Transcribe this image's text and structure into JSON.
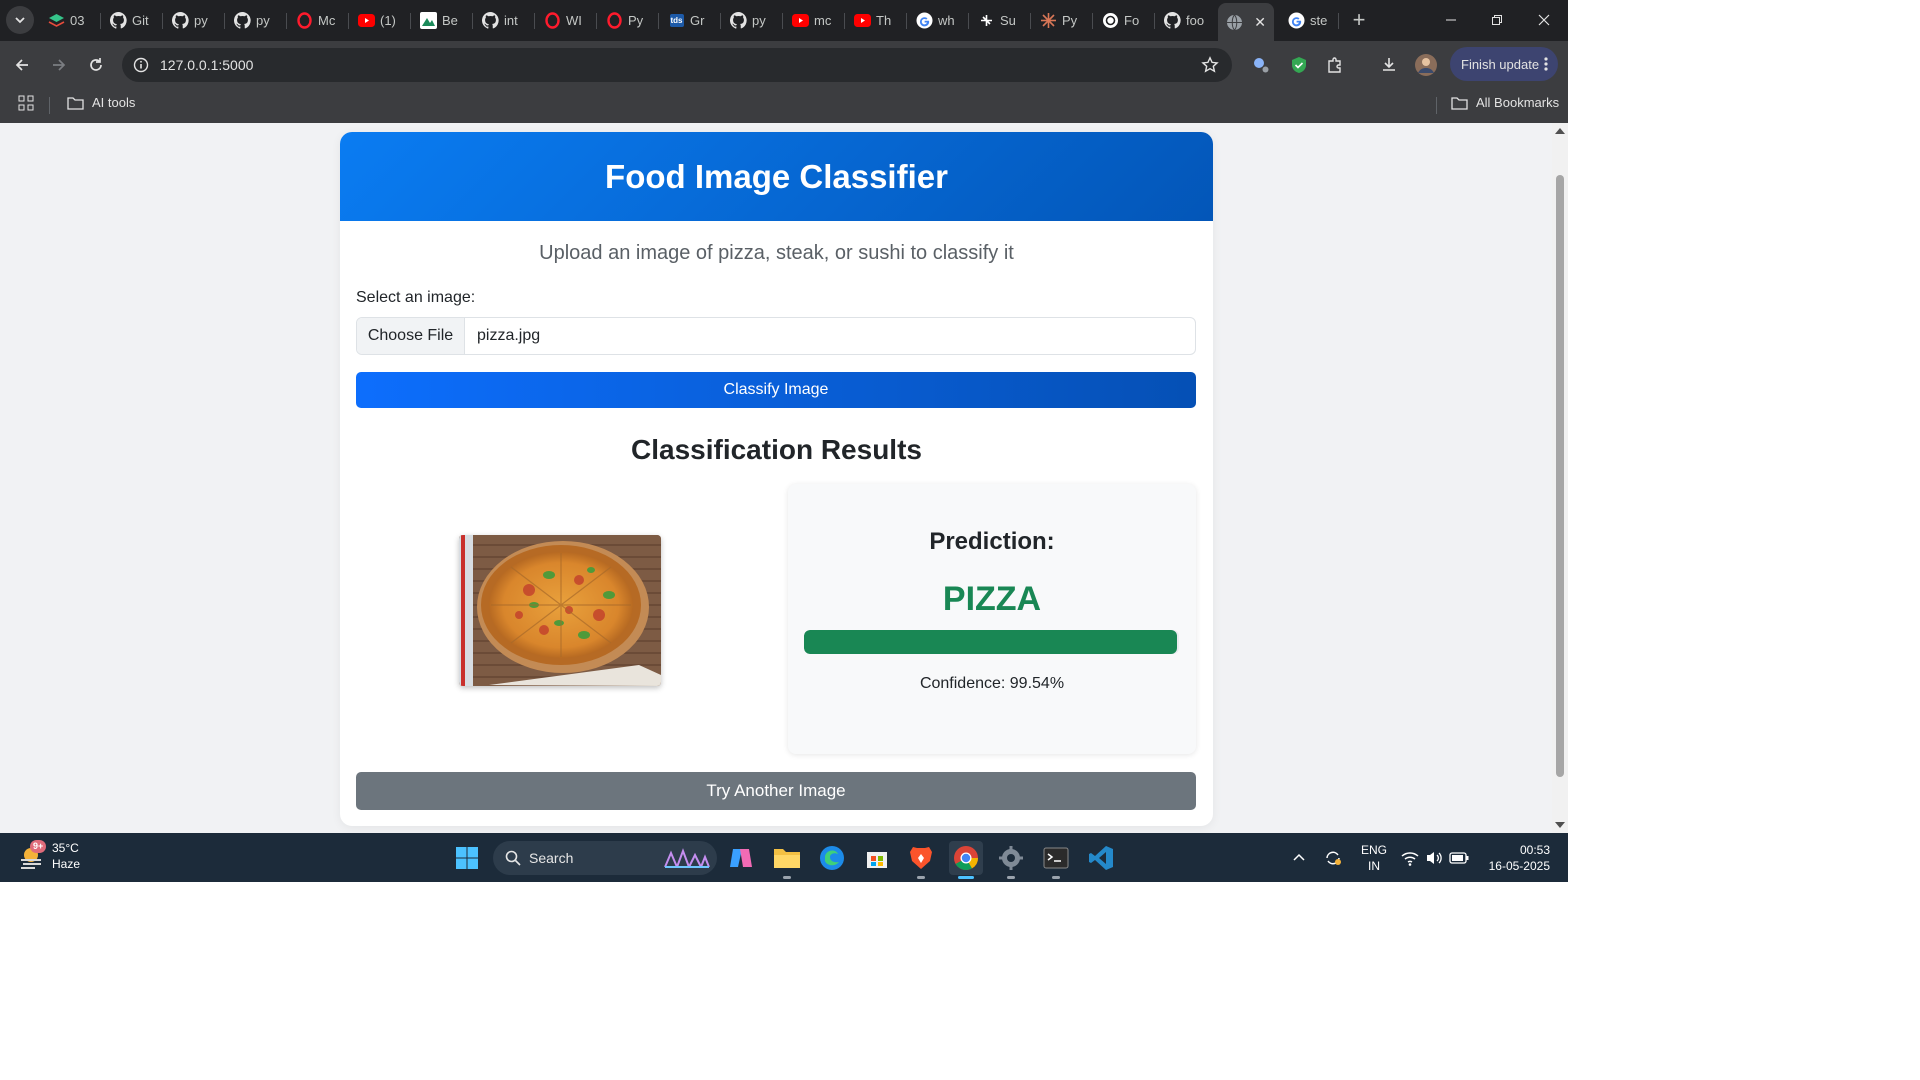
{
  "browser": {
    "tabs": [
      {
        "title": "03",
        "icon": "layers-icon",
        "color": "#35c48a"
      },
      {
        "title": "Git",
        "icon": "github-icon"
      },
      {
        "title": "py",
        "icon": "github-icon"
      },
      {
        "title": "py",
        "icon": "github-icon"
      },
      {
        "title": "Mc",
        "icon": "opera-icon",
        "color": "#ff1b2d"
      },
      {
        "title": "(1)",
        "icon": "youtube-icon",
        "color": "#ff0000"
      },
      {
        "title": "Be",
        "icon": "mountain-icon"
      },
      {
        "title": "int",
        "icon": "github-icon"
      },
      {
        "title": "WI",
        "icon": "opera-icon",
        "color": "#ff1b2d"
      },
      {
        "title": "Py",
        "icon": "opera-icon",
        "color": "#ff1b2d"
      },
      {
        "title": "Gr",
        "icon": "tds-icon",
        "favtext": "tds"
      },
      {
        "title": "py",
        "icon": "github-icon"
      },
      {
        "title": "mc",
        "icon": "youtube-icon",
        "color": "#ff0000"
      },
      {
        "title": "Th",
        "icon": "youtube-icon",
        "color": "#ff0000"
      },
      {
        "title": "wh",
        "icon": "google-icon"
      },
      {
        "title": "Su",
        "icon": "perplexity-icon"
      },
      {
        "title": "Py",
        "icon": "claude-icon",
        "color": "#d97757"
      },
      {
        "title": "Fo",
        "icon": "openai-icon"
      },
      {
        "title": "foo",
        "icon": "github-icon"
      },
      {
        "title": "",
        "icon": "globe-icon",
        "active": true
      },
      {
        "title": "ste",
        "icon": "google-icon"
      }
    ],
    "address": "127.0.0.1:5000",
    "finish_update_label": "Finish update",
    "bookmarks": {
      "folder": "AI tools",
      "all": "All Bookmarks"
    }
  },
  "page": {
    "title": "Food Image Classifier",
    "subtitle": "Upload an image of pizza, steak, or sushi to classify it",
    "select_label": "Select an image:",
    "choose_file_label": "Choose File",
    "file_name": "pizza.jpg",
    "classify_button": "Classify Image",
    "results_title": "Classification Results",
    "prediction_label": "Prediction:",
    "prediction_value": "PIZZA",
    "confidence_percent": 99.54,
    "confidence_text": "Confidence: 99.54%",
    "try_another_button": "Try Another Image",
    "colors": {
      "header": "#0a7cf2",
      "success": "#198754",
      "secondary": "#6c757d"
    }
  },
  "taskbar": {
    "weather": {
      "temp": "35°C",
      "cond": "Haze",
      "badge": "9+"
    },
    "search_label": "Search",
    "lang_line1": "ENG",
    "lang_line2": "IN",
    "time": "00:53",
    "date": "16-05-2025"
  }
}
